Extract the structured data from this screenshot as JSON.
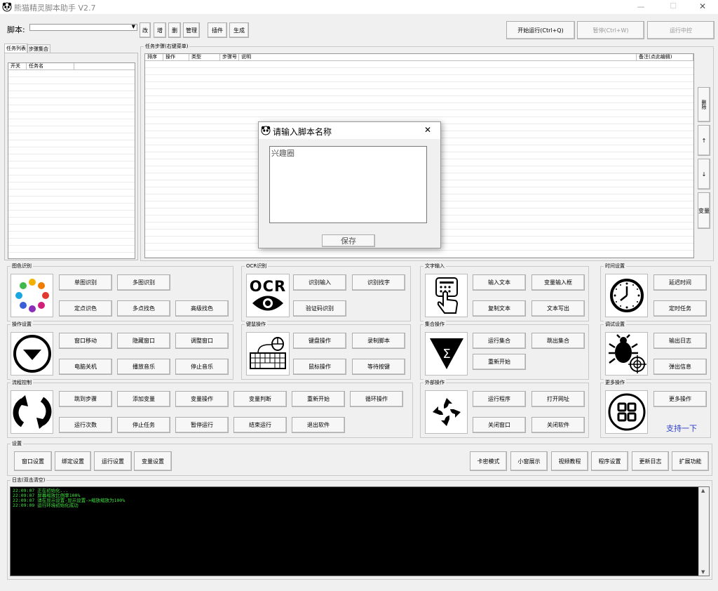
{
  "window": {
    "title": "熊猫精灵脚本助手  V2.7",
    "min": "—",
    "max": "☐",
    "close": "✕"
  },
  "toolbar": {
    "script_label": "脚本:",
    "script_value": "",
    "btn_edit": "改",
    "btn_add": "增",
    "btn_delete": "删",
    "btn_manage": "管理",
    "btn_plugin": "插件",
    "btn_generate": "生成",
    "btn_start": "开始运行(Ctrl+Q)",
    "btn_pause": "暂停(Ctrl+W)",
    "btn_stop": "运行中控"
  },
  "left_panel": {
    "tab_tasks": "任务列表",
    "tab_steps_collection": "步骤集合",
    "col_switch": "开关",
    "col_task_name": "任务名"
  },
  "steps_panel": {
    "title": "任务步骤(右键菜单)",
    "cols": [
      "排序",
      "操作",
      "类型",
      "步骤号",
      "说明",
      "备注(点此编辑)"
    ],
    "side_buttons": {
      "delete": "删除",
      "up": "↑",
      "down": "↓",
      "variable": "变量"
    }
  },
  "dialog": {
    "title": "请输入脚本名称",
    "value": "兴趣圈",
    "save": "保存",
    "close": "✕"
  },
  "groups": {
    "image": {
      "title": "图色识别",
      "buttons": [
        "单图识别",
        "多图识别",
        "定点识色",
        "多点找色",
        "高级找色"
      ]
    },
    "ocr": {
      "title": "OCR识别",
      "icon_text": "OCR",
      "buttons": [
        "识别输入",
        "识别找字",
        "验证码识别"
      ]
    },
    "text": {
      "title": "文字输入",
      "buttons": [
        "输入文本",
        "变量输入框",
        "复制文本",
        "文本写出"
      ]
    },
    "time": {
      "title": "时间设置",
      "buttons": [
        "延迟时间",
        "定时任务"
      ]
    },
    "operate": {
      "title": "操作设置",
      "buttons": [
        "窗口移动",
        "隐藏窗口",
        "调整窗口",
        "电脑关机",
        "播放音乐",
        "停止音乐"
      ]
    },
    "keyboard": {
      "title": "键鼠操作",
      "buttons": [
        "键盘操作",
        "录制脚本",
        "鼠标操作",
        "等待按键"
      ]
    },
    "collection": {
      "title": "集合操作",
      "buttons": [
        "运行集合",
        "跳出集合",
        "重新开始"
      ]
    },
    "debug": {
      "title": "调试设置",
      "buttons": [
        "输出日志",
        "弹出信息"
      ]
    },
    "flow": {
      "title": "流程控制",
      "buttons": [
        "跳到步骤",
        "添加变量",
        "变量操作",
        "变量判断",
        "重新开始",
        "循环操作",
        "运行次数",
        "停止任务",
        "暂停运行",
        "结束运行",
        "退出软件"
      ]
    },
    "external": {
      "title": "外部操作",
      "buttons": [
        "运行程序",
        "打开网址",
        "关闭窗口",
        "关闭软件"
      ]
    },
    "more": {
      "title": "更多操作",
      "buttons": [
        "更多操作"
      ],
      "support_link": "支持一下"
    }
  },
  "settings": {
    "title": "设置",
    "left_buttons": [
      "窗口设置",
      "绑定设置",
      "运行设置",
      "变量设置"
    ],
    "right_buttons": [
      "卡密模式",
      "小窗展示",
      "视频教程",
      "程序设置",
      "更新日志",
      "扩展功能"
    ]
  },
  "log": {
    "title": "日志(双击清空)",
    "lines": [
      "22:09:07  正在初始化...",
      "22:09:07  屏幕缩放比例率100%",
      "22:09:07  请在显示设置-显示设置->缩放缩放为100%",
      "22:09:09  运行环境初始化成功"
    ]
  },
  "colors": {
    "log_bg": "#000000",
    "log_text": "#3fe13f",
    "support_link": "#2b3dc9"
  }
}
